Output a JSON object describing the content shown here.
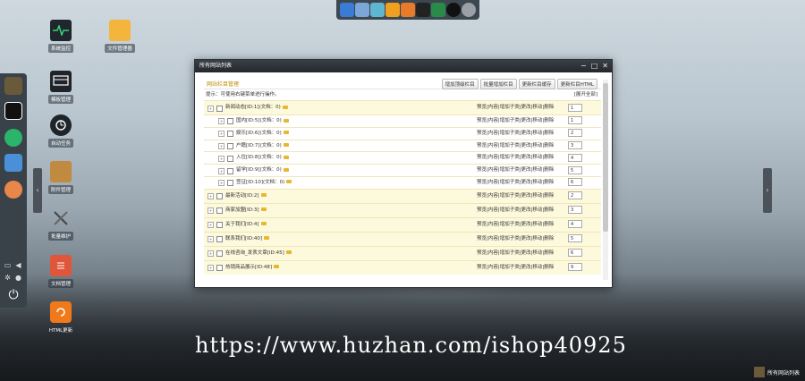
{
  "top_dock": {
    "icons": [
      "globe-icon",
      "house-icon",
      "briefcase-icon",
      "pie-chart-icon",
      "basketball-icon",
      "calculator-icon",
      "user-icon",
      "ball-icon",
      "gear-icon"
    ]
  },
  "left_dock": {
    "icons": [
      "columns-icon",
      "document-icon",
      "chat-icon",
      "drive-icon",
      "notes-icon"
    ],
    "small_icons": [
      "monitor-icon",
      "volume-icon",
      "settings-icon",
      "theme-icon"
    ],
    "power_icon": "power-icon"
  },
  "desktop_icons": [
    {
      "label": "系统监控",
      "icon": "activity-monitor-icon"
    },
    {
      "label": "文件管理器",
      "icon": "folder-icon"
    },
    {
      "label": "模板管理",
      "icon": "template-icon"
    },
    {
      "label": "自动任务",
      "icon": "task-icon"
    },
    {
      "label": "附件管理",
      "icon": "box-icon"
    },
    {
      "label": "批量维护",
      "icon": "tools-icon"
    },
    {
      "label": "文档管理",
      "icon": "document-manage-icon"
    },
    {
      "label": "HTML更新",
      "icon": "refresh-icon"
    }
  ],
  "window": {
    "title": "所有网站列表",
    "controls": [
      "−",
      "□",
      "✕"
    ],
    "toolbar_title": "网站栏目管理",
    "buttons": [
      "增加顶级栏目",
      "批量增加栏目",
      "更新栏目缓存",
      "更新栏目HTML"
    ],
    "tip": "提示：可使用右键菜单进行操作。",
    "expand_all": "[展开全部]",
    "action_text": "预览|内容|增加子类|更改|移动|删除",
    "rows": [
      {
        "name": "新闻动态[ID:1](文档：0)",
        "order": "1",
        "level": "top"
      },
      {
        "name": "国内[ID:5](文档：0)",
        "order": "1",
        "level": "sub"
      },
      {
        "name": "娱乐[ID:6](文档：0)",
        "order": "2",
        "level": "sub"
      },
      {
        "name": "户籍[ID:7](文档：0)",
        "order": "3",
        "level": "sub"
      },
      {
        "name": "入住[ID:8](文档：0)",
        "order": "4",
        "level": "sub"
      },
      {
        "name": "留学[ID:9](文档：0)",
        "order": "5",
        "level": "sub"
      },
      {
        "name": "签证[ID:10](文档：0)",
        "order": "6",
        "level": "sub"
      },
      {
        "name": "最新活动[ID:2]",
        "order": "2",
        "level": "top"
      },
      {
        "name": "商家加盟[ID:3]",
        "order": "3",
        "level": "top"
      },
      {
        "name": "关于我们[ID:4]",
        "order": "4",
        "level": "top"
      },
      {
        "name": "联系我们[ID:40]",
        "order": "5",
        "level": "top"
      },
      {
        "name": "在线咨询_发表文章[ID:45]",
        "order": "6",
        "level": "top"
      },
      {
        "name": "热销商品展示[ID:48]",
        "order": "9",
        "level": "top"
      }
    ]
  },
  "watermark": "https://www.huzhan.com/ishop40925",
  "bottom_right_label": "所有网站列表"
}
